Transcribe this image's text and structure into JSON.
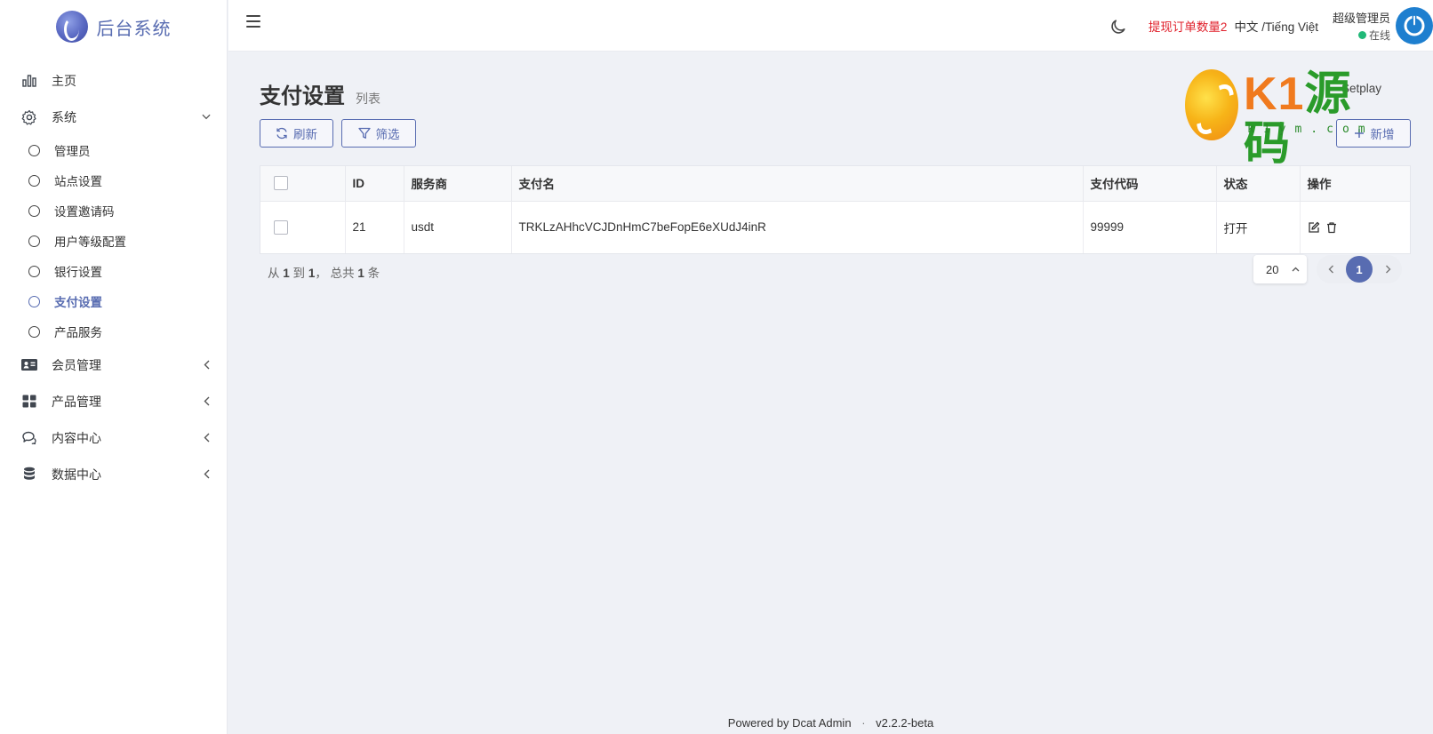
{
  "brand": {
    "name": "后台系统"
  },
  "sidebar": {
    "items": [
      {
        "label": "主页",
        "icon": "bar-chart-icon"
      },
      {
        "label": "系统",
        "icon": "gear-icon",
        "expanded": true,
        "children": [
          {
            "label": "管理员"
          },
          {
            "label": "站点设置"
          },
          {
            "label": "设置邀请码"
          },
          {
            "label": "用户等级配置"
          },
          {
            "label": "银行设置"
          },
          {
            "label": "支付设置",
            "active": true
          },
          {
            "label": "产品服务"
          }
        ]
      },
      {
        "label": "会员管理",
        "icon": "id-card-icon"
      },
      {
        "label": "产品管理",
        "icon": "grid-icon"
      },
      {
        "label": "内容中心",
        "icon": "comments-icon"
      },
      {
        "label": "数据中心",
        "icon": "database-icon"
      }
    ]
  },
  "topbar": {
    "withdraw_label": "提现订单数量2",
    "lang_label": "中文 /Tiếng Việt",
    "user_name": "超级管理员",
    "user_status": "在线",
    "accent_red": "#e0202b",
    "status_green": "#21b978"
  },
  "page": {
    "title": "支付设置",
    "description": "列表",
    "breadcrumb_visible": "Setplay",
    "accent": "#586cb1"
  },
  "toolbar": {
    "refresh_label": "刷新",
    "filter_label": "筛选",
    "create_label": "新增"
  },
  "table": {
    "headers": {
      "id": "ID",
      "provider": "服务商",
      "pay_name": "支付名",
      "pay_code": "支付代码",
      "status": "状态",
      "actions": "操作"
    },
    "rows": [
      {
        "id": "21",
        "provider": "usdt",
        "pay_name": "TRKLzAHhcVCJDnHmC7beFopE6eXUdJ4inR",
        "pay_code": "99999",
        "status": "打开"
      }
    ]
  },
  "pagination": {
    "summary_from": "从",
    "summary_start": "1",
    "summary_to": "到",
    "summary_end": "1",
    "summary_total_prefix": "， 总共",
    "summary_total": "1",
    "summary_unit": "条",
    "per_page": "20",
    "current_page": "1"
  },
  "footer": {
    "powered_by": "Powered by",
    "product": "Dcat Admin",
    "separator": "·",
    "version": "v2.2.2-beta"
  },
  "watermark": {
    "k1": "K1",
    "ym": "源码",
    "url": "k1ym.com"
  }
}
